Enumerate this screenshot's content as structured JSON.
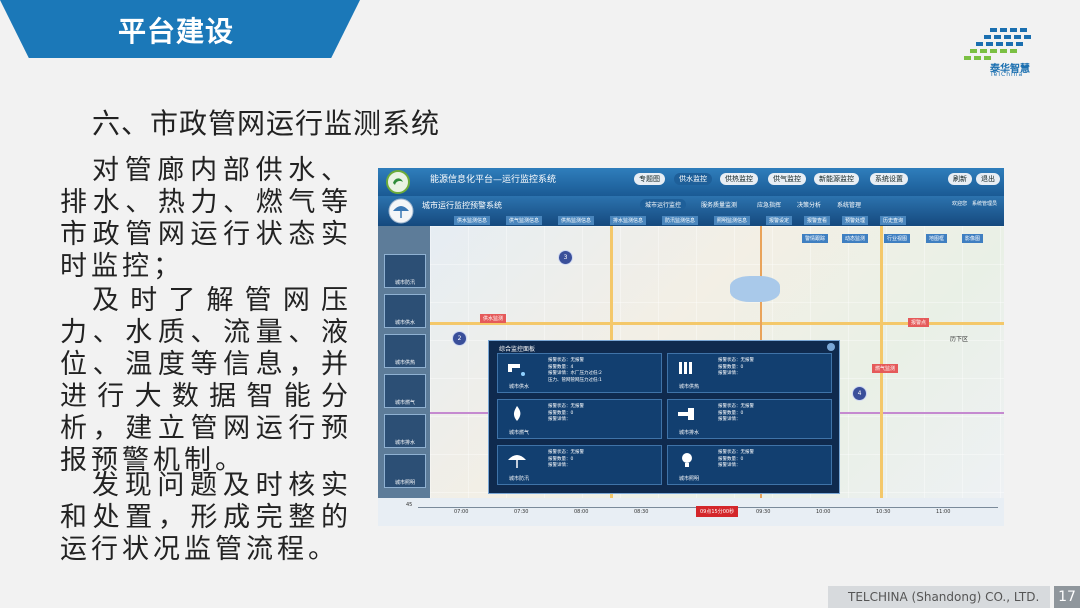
{
  "slide": {
    "banner_title": "平台建设",
    "heading": "六、市政管网运行监测系统",
    "paragraphs": [
      "对管廊内部供水、排水、热力、燃气等市政管网运行状态实时监控；",
      "及时了解管网压力、水质、流量、液位、温度等信息，并进行大数据智能分析，建立管网运行预报预警机制。",
      "发现问题及时核实和处置，形成完整的运行状况监管流程。"
    ],
    "footer": "TELCHINA (Shandong) CO., LTD.",
    "page_number": "17"
  },
  "logo": {
    "name": "泰华智慧",
    "subtitle": "TelChina",
    "colors": [
      "#1b6fb0",
      "#7bc043"
    ]
  },
  "screenshot": {
    "top_title": "能源信息化平台—运行监控系统",
    "top_nav": [
      "专题图",
      "供水监控",
      "供热监控",
      "供气监控",
      "新能源监控",
      "系统设置"
    ],
    "top_nav_active": "供水监控",
    "top_right": [
      "刷新",
      "退出"
    ],
    "sub_title": "城市运行监控预警系统",
    "sub_nav": [
      "城市运行监控",
      "服务质量监测",
      "应急指挥",
      "决策分析",
      "系统管理"
    ],
    "sub_nav_active": "城市运行监控",
    "user": [
      "欢迎您",
      "系统管理员"
    ],
    "sub_tabs": [
      "供水监测信息",
      "供气监测信息",
      "供热监测信息",
      "排水监测信息",
      "防汛监测信息",
      "照明监测信息",
      "报警设定",
      "报警查看",
      "预警处理",
      "历史查询"
    ],
    "toolbar": [
      "警情跟踪",
      "动态监测",
      "行业视图",
      "地图框",
      "影像图"
    ],
    "sidebar": [
      "城市防汛",
      "城市供水",
      "城市供热",
      "城市燃气",
      "城市排水",
      "城市照明"
    ],
    "map_labels": [
      "历下区"
    ],
    "alerts": [
      "供水监测",
      "报警点",
      "燃气监测"
    ],
    "cluster_counts": [
      "3",
      "2",
      "4"
    ],
    "popup": {
      "title": "综合监控面板",
      "cells": [
        {
          "name": "城市供水",
          "lines": [
            "报警状态：无报警",
            "报警数量：4",
            "报警详情：水厂压力过低:2",
            "压力、管网管网压力过低:1"
          ]
        },
        {
          "name": "城市供热",
          "lines": [
            "报警状态：无报警",
            "报警数量：0",
            "报警详情："
          ]
        },
        {
          "name": "城市燃气",
          "lines": [
            "报警状态：无报警",
            "报警数量：0",
            "报警详情："
          ]
        },
        {
          "name": "城市排水",
          "lines": [
            "报警状态：无报警",
            "报警数量：0",
            "报警详情："
          ]
        },
        {
          "name": "城市防汛",
          "lines": [
            "报警状态：无报警",
            "报警数量：0",
            "报警详情："
          ]
        },
        {
          "name": "城市照明",
          "lines": [
            "报警状态：无报警",
            "报警数量：0",
            "报警详情："
          ]
        }
      ]
    },
    "timeline": {
      "ticks": [
        "07:00",
        "07:30",
        "08:00",
        "08:30",
        "09:30",
        "10:00",
        "10:30",
        "11:00"
      ],
      "now_label": "09点15分00秒",
      "left_value": "45"
    }
  }
}
